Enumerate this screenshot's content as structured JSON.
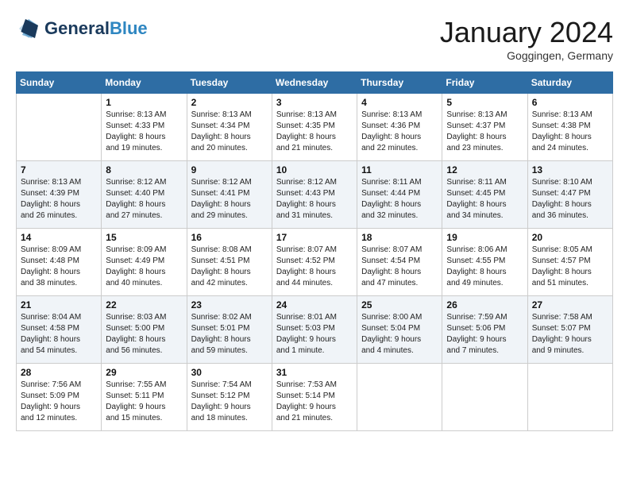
{
  "header": {
    "logo_general": "General",
    "logo_blue": "Blue",
    "month_title": "January 2024",
    "location": "Goggingen, Germany"
  },
  "weekdays": [
    "Sunday",
    "Monday",
    "Tuesday",
    "Wednesday",
    "Thursday",
    "Friday",
    "Saturday"
  ],
  "weeks": [
    {
      "shaded": false,
      "days": [
        {
          "date": "",
          "info": ""
        },
        {
          "date": "1",
          "info": "Sunrise: 8:13 AM\nSunset: 4:33 PM\nDaylight: 8 hours\nand 19 minutes."
        },
        {
          "date": "2",
          "info": "Sunrise: 8:13 AM\nSunset: 4:34 PM\nDaylight: 8 hours\nand 20 minutes."
        },
        {
          "date": "3",
          "info": "Sunrise: 8:13 AM\nSunset: 4:35 PM\nDaylight: 8 hours\nand 21 minutes."
        },
        {
          "date": "4",
          "info": "Sunrise: 8:13 AM\nSunset: 4:36 PM\nDaylight: 8 hours\nand 22 minutes."
        },
        {
          "date": "5",
          "info": "Sunrise: 8:13 AM\nSunset: 4:37 PM\nDaylight: 8 hours\nand 23 minutes."
        },
        {
          "date": "6",
          "info": "Sunrise: 8:13 AM\nSunset: 4:38 PM\nDaylight: 8 hours\nand 24 minutes."
        }
      ]
    },
    {
      "shaded": true,
      "days": [
        {
          "date": "7",
          "info": "Sunrise: 8:13 AM\nSunset: 4:39 PM\nDaylight: 8 hours\nand 26 minutes."
        },
        {
          "date": "8",
          "info": "Sunrise: 8:12 AM\nSunset: 4:40 PM\nDaylight: 8 hours\nand 27 minutes."
        },
        {
          "date": "9",
          "info": "Sunrise: 8:12 AM\nSunset: 4:41 PM\nDaylight: 8 hours\nand 29 minutes."
        },
        {
          "date": "10",
          "info": "Sunrise: 8:12 AM\nSunset: 4:43 PM\nDaylight: 8 hours\nand 31 minutes."
        },
        {
          "date": "11",
          "info": "Sunrise: 8:11 AM\nSunset: 4:44 PM\nDaylight: 8 hours\nand 32 minutes."
        },
        {
          "date": "12",
          "info": "Sunrise: 8:11 AM\nSunset: 4:45 PM\nDaylight: 8 hours\nand 34 minutes."
        },
        {
          "date": "13",
          "info": "Sunrise: 8:10 AM\nSunset: 4:47 PM\nDaylight: 8 hours\nand 36 minutes."
        }
      ]
    },
    {
      "shaded": false,
      "days": [
        {
          "date": "14",
          "info": "Sunrise: 8:09 AM\nSunset: 4:48 PM\nDaylight: 8 hours\nand 38 minutes."
        },
        {
          "date": "15",
          "info": "Sunrise: 8:09 AM\nSunset: 4:49 PM\nDaylight: 8 hours\nand 40 minutes."
        },
        {
          "date": "16",
          "info": "Sunrise: 8:08 AM\nSunset: 4:51 PM\nDaylight: 8 hours\nand 42 minutes."
        },
        {
          "date": "17",
          "info": "Sunrise: 8:07 AM\nSunset: 4:52 PM\nDaylight: 8 hours\nand 44 minutes."
        },
        {
          "date": "18",
          "info": "Sunrise: 8:07 AM\nSunset: 4:54 PM\nDaylight: 8 hours\nand 47 minutes."
        },
        {
          "date": "19",
          "info": "Sunrise: 8:06 AM\nSunset: 4:55 PM\nDaylight: 8 hours\nand 49 minutes."
        },
        {
          "date": "20",
          "info": "Sunrise: 8:05 AM\nSunset: 4:57 PM\nDaylight: 8 hours\nand 51 minutes."
        }
      ]
    },
    {
      "shaded": true,
      "days": [
        {
          "date": "21",
          "info": "Sunrise: 8:04 AM\nSunset: 4:58 PM\nDaylight: 8 hours\nand 54 minutes."
        },
        {
          "date": "22",
          "info": "Sunrise: 8:03 AM\nSunset: 5:00 PM\nDaylight: 8 hours\nand 56 minutes."
        },
        {
          "date": "23",
          "info": "Sunrise: 8:02 AM\nSunset: 5:01 PM\nDaylight: 8 hours\nand 59 minutes."
        },
        {
          "date": "24",
          "info": "Sunrise: 8:01 AM\nSunset: 5:03 PM\nDaylight: 9 hours\nand 1 minute."
        },
        {
          "date": "25",
          "info": "Sunrise: 8:00 AM\nSunset: 5:04 PM\nDaylight: 9 hours\nand 4 minutes."
        },
        {
          "date": "26",
          "info": "Sunrise: 7:59 AM\nSunset: 5:06 PM\nDaylight: 9 hours\nand 7 minutes."
        },
        {
          "date": "27",
          "info": "Sunrise: 7:58 AM\nSunset: 5:07 PM\nDaylight: 9 hours\nand 9 minutes."
        }
      ]
    },
    {
      "shaded": false,
      "days": [
        {
          "date": "28",
          "info": "Sunrise: 7:56 AM\nSunset: 5:09 PM\nDaylight: 9 hours\nand 12 minutes."
        },
        {
          "date": "29",
          "info": "Sunrise: 7:55 AM\nSunset: 5:11 PM\nDaylight: 9 hours\nand 15 minutes."
        },
        {
          "date": "30",
          "info": "Sunrise: 7:54 AM\nSunset: 5:12 PM\nDaylight: 9 hours\nand 18 minutes."
        },
        {
          "date": "31",
          "info": "Sunrise: 7:53 AM\nSunset: 5:14 PM\nDaylight: 9 hours\nand 21 minutes."
        },
        {
          "date": "",
          "info": ""
        },
        {
          "date": "",
          "info": ""
        },
        {
          "date": "",
          "info": ""
        }
      ]
    }
  ]
}
